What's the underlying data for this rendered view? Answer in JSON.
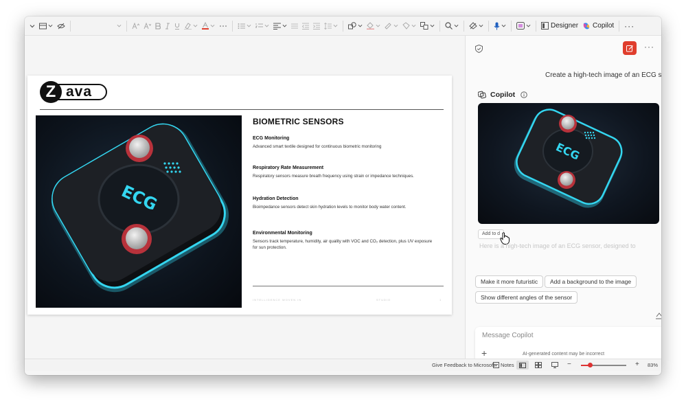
{
  "ribbon": {
    "designer_label": "Designer",
    "copilot_label": "Copilot",
    "more_label": "···"
  },
  "slide": {
    "logo_letter": "Z",
    "logo_rest": "ava",
    "image_text": "ECG",
    "title": "BIOMETRIC SENSORS",
    "sections": [
      {
        "heading": "ECG Monitoring",
        "body": "Advanced smart textile designed for continuous biometric monitoring"
      },
      {
        "heading": "Respiratory Rate Measurement",
        "body": "Respiratory sensors measure breath frequency using strain or impedance techniques."
      },
      {
        "heading": "Hydration Detection",
        "body": "Bioimpedance sensors detect skin hydration levels to monitor body water content."
      },
      {
        "heading": "Environmental Monitoring",
        "body": "Sensors track temperature, humidity, air quality with VOC and CO₂ detection, plus UV exposure for sun protection."
      }
    ],
    "footer_left": "INTELLIGENCE WOVEN IN",
    "footer_mid": "STUDIO",
    "footer_right": "1"
  },
  "copilot": {
    "prompt_text": "Create a high-tech image of an ECG sensor",
    "header_label": "Copilot",
    "image_text": "ECG",
    "add_to_label": "Add to d",
    "faded_text": "Here is a high-tech image of an ECG sensor, designed to",
    "suggestions": [
      "Make it more futuristic",
      "Add a background to the image",
      "Show different angles of the sensor"
    ],
    "message_placeholder": "Message Copilot",
    "plus_label": "+",
    "disclaimer": "AI-generated content may be incorrect"
  },
  "status": {
    "feedback": "Give Feedback to Microsoft",
    "notes": "Notes",
    "zoom_minus": "−",
    "zoom_plus": "+",
    "zoom": "83%",
    "zoom_fraction": 0.2
  },
  "colors": {
    "accent_red": "#e03e2d",
    "glow_cyan": "#34d6f0",
    "ribbon_bg": "#f3f3f3"
  }
}
